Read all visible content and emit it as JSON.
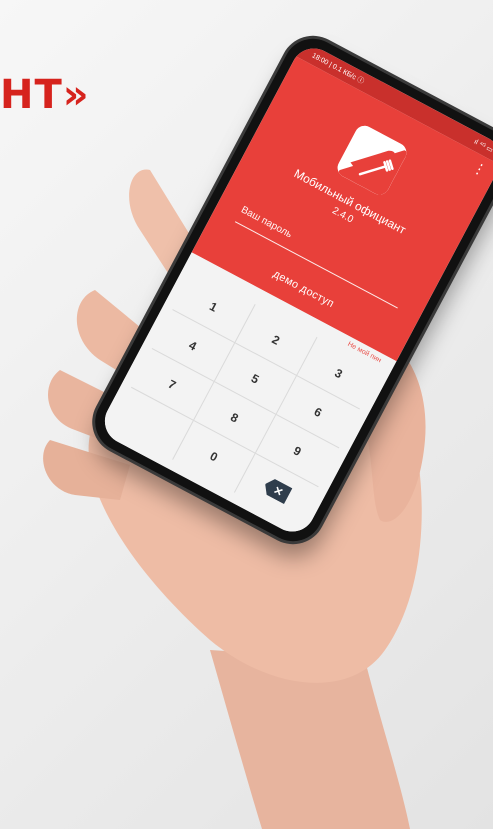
{
  "headline": "НТ»",
  "phone": {
    "status_left": "18:00 | 0.1 КБ/с ⓘ",
    "status_right": "ıl ⁴ᴳ ▭",
    "menu_icon": "more-vert-icon",
    "logo_icon": "knife-fork-icon",
    "app_title": "Мобильный официант",
    "app_version": "2.4.0",
    "password_label": "Ваш пароль",
    "demo_access": "демо доступ",
    "forgot_link": "Не мой пин",
    "keys": [
      "1",
      "2",
      "3",
      "4",
      "5",
      "6",
      "7",
      "8",
      "9",
      "",
      "0",
      ""
    ],
    "backspace_icon": "backspace-icon",
    "backspace_glyph": "✕",
    "accent_color": "#e8403a",
    "status_color": "#c9302c"
  }
}
